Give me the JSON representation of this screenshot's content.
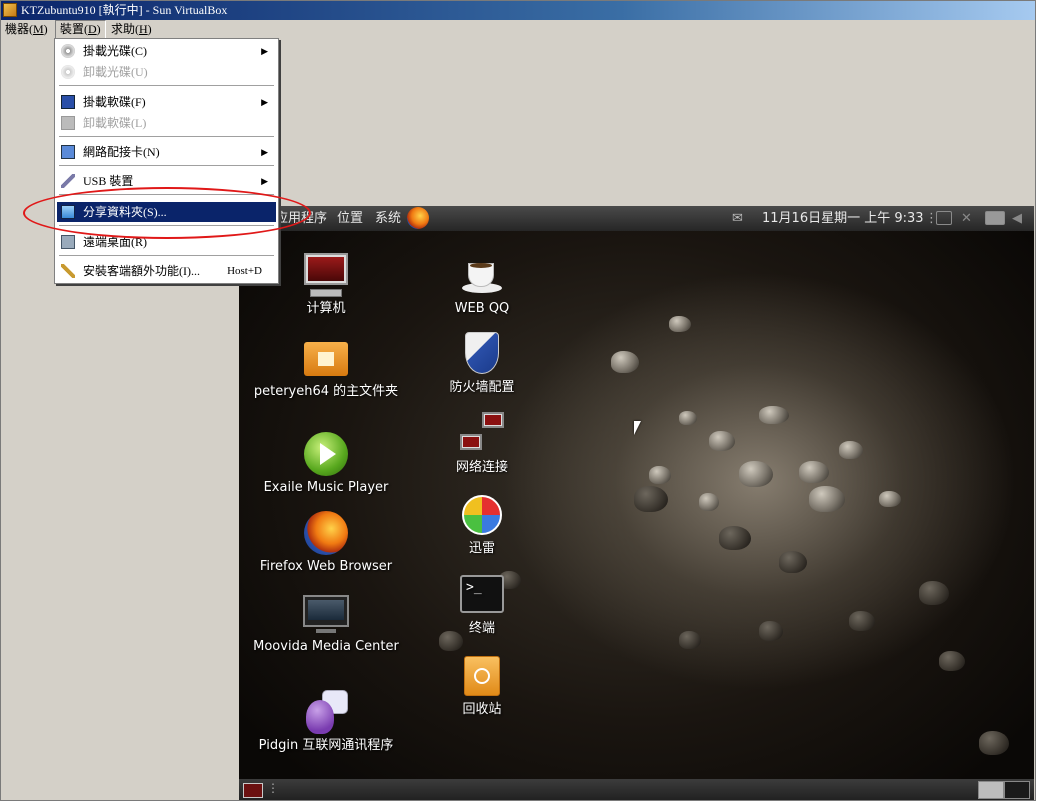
{
  "window": {
    "title": "KTZubuntu910 [執行中] - Sun VirtualBox"
  },
  "menubar": {
    "items": [
      {
        "label": "機器(",
        "key": "M",
        "suffix": ")"
      },
      {
        "label": "裝置(",
        "key": "D",
        "suffix": ")"
      },
      {
        "label": "求助(",
        "key": "H",
        "suffix": ")"
      }
    ]
  },
  "devices_menu": {
    "items": [
      {
        "label": "掛載光碟(C)",
        "enabled": true,
        "submenu": true
      },
      {
        "label": "卸載光碟(U)",
        "enabled": false,
        "submenu": false
      },
      {
        "label": "掛載軟碟(F)",
        "enabled": true,
        "submenu": true
      },
      {
        "label": "卸載軟碟(L)",
        "enabled": false,
        "submenu": false
      },
      {
        "label": "網路配接卡(N)",
        "enabled": true,
        "submenu": true
      },
      {
        "label": "USB 裝置",
        "enabled": true,
        "submenu": true
      },
      {
        "label": "分享資料夾(S)...",
        "enabled": true,
        "highlighted": true
      },
      {
        "label": "遠端桌面(R)",
        "enabled": true,
        "submenu": false
      },
      {
        "label": "安裝客端額外功能(I)...",
        "enabled": true,
        "shortcut": "Host+D"
      }
    ]
  },
  "guest": {
    "top_panel": {
      "applications": "应用程序",
      "places": "位置",
      "system": "系统",
      "clock": "11月16日星期一 上午 9:33"
    },
    "desktop_icons_col1": [
      {
        "label": "计算机",
        "icon": "computer-icon"
      },
      {
        "label": "peteryeh64 的主文件夹",
        "icon": "home-folder-icon"
      },
      {
        "label": "Exaile Music Player",
        "icon": "play-icon"
      },
      {
        "label": "Firefox Web Browser",
        "icon": "firefox-icon"
      },
      {
        "label": "Moovida Media Center",
        "icon": "media-center-icon"
      },
      {
        "label": "Pidgin 互联网通讯程序",
        "icon": "pidgin-icon"
      }
    ],
    "desktop_icons_col2": [
      {
        "label": "WEB QQ",
        "icon": "coffee-cup-icon"
      },
      {
        "label": "防火墙配置",
        "icon": "shield-icon"
      },
      {
        "label": "网络连接",
        "icon": "network-icon"
      },
      {
        "label": "迅雷",
        "icon": "pinwheel-icon"
      },
      {
        "label": "终端",
        "icon": "terminal-icon"
      },
      {
        "label": "回收站",
        "icon": "trash-icon"
      }
    ]
  },
  "colors": {
    "highlight": "#0a246a",
    "annotation": "#e01818"
  }
}
